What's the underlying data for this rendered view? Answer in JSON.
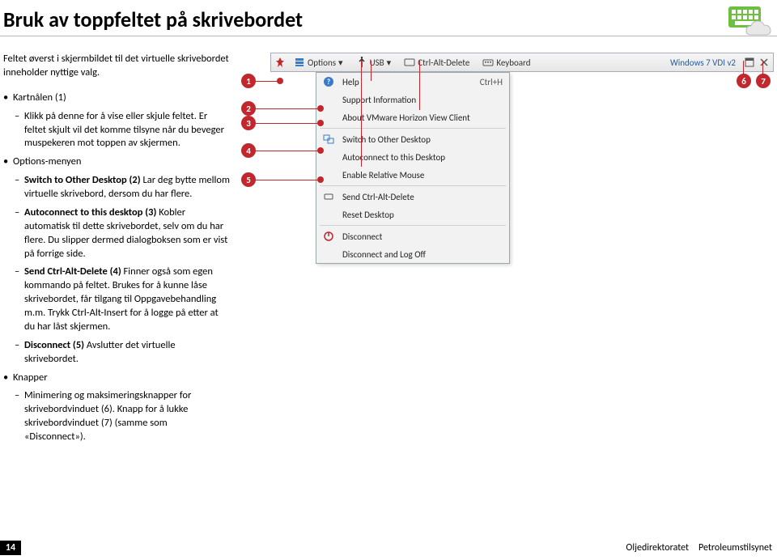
{
  "page": {
    "title": "Bruk av toppfeltet på skrivebordet",
    "intro": "Feltet øverst i skjermbildet til det virtuelle skrivebordet inneholder nyttige valg.",
    "pageNumber": "14",
    "footerLeft": "Oljedirektoratet",
    "footerRight": "Petroleumstilsynet"
  },
  "bullets": {
    "kartnalen": "Kartnålen (1)",
    "kartnalenBody": "Klikk på denne for å vise eller skjule feltet. Er feltet skjult vil det komme tilsyne når du beveger muspekeren mot toppen av skjermen.",
    "options": "Options-menyen",
    "opt2Lead": "Switch to Other Desktop (2)",
    "opt2Body": " Lar deg bytte mellom virtuelle skrivebord, dersom du har flere.",
    "opt3Lead": "Autoconnect to this desktop (3)",
    "opt3Body": " Kobler automatisk til dette skrive­bordet, selv om du har flere. Du slipper dermed dialogboksen som er vist på forrige side.",
    "opt4Lead": "Send Ctrl-Alt-Delete (4)",
    "opt4Body": " Finner også som egen kommando på feltet. Brukes for å kunne låse skrive­bordet, får tilgang til Oppgavebe­handling m.m.  Trykk Ctrl-Alt-Insert for å logge på etter at du har låst skjermen.",
    "opt5Lead": "Disconnect (5)",
    "opt5Body": " Avslutter det virtuelle skrivebordet.",
    "knapper": "Knapper",
    "knapperBody": "Minimering og maksimeringsknapper for skrivebordvinduet (6). Knapp for å lukke skrivebordvinduet (7) (samme som «Disconnect»).",
    "dash": "–"
  },
  "callouts": {
    "c1": "1",
    "c2": "2",
    "c3": "3",
    "c4": "4",
    "c5": "5",
    "c6": "6",
    "c7": "7"
  },
  "toolbar": {
    "options": "Options",
    "usb": "USB",
    "cad": "Ctrl-Alt-Delete",
    "keyboard": "Keyboard",
    "vmname": "Windows 7 VDI v2",
    "dropdown": "▾"
  },
  "menu": {
    "help": "Help",
    "helpShortcut": "Ctrl+H",
    "support": "Support Information",
    "about": "About VMware Horizon View Client",
    "switch": "Switch to Other Desktop",
    "autoconnect": "Autoconnect to this Desktop",
    "enablemouse": "Enable Relative Mouse",
    "sendcad": "Send Ctrl-Alt-Delete",
    "reset": "Reset Desktop",
    "disconnect": "Disconnect",
    "disconnectLogoff": "Disconnect and Log Off"
  }
}
